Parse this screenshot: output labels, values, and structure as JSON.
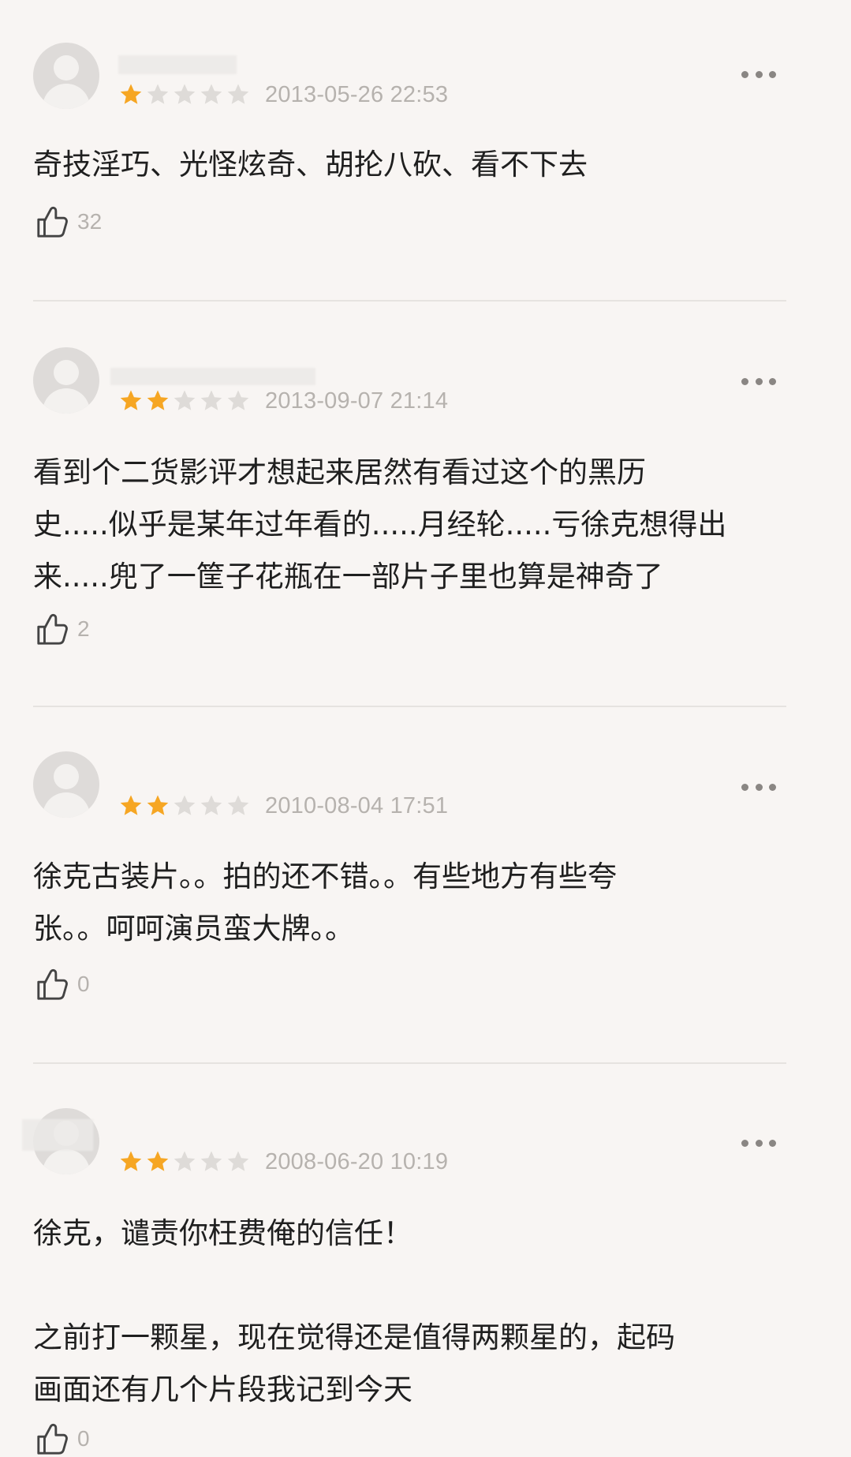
{
  "reviews": [
    {
      "rating": 1,
      "rating_max": 5,
      "date": "2013-05-26 22:53",
      "text": "奇技淫巧、光怪炫奇、胡抡八砍、看不下去",
      "likes": "32"
    },
    {
      "rating": 2,
      "rating_max": 5,
      "date": "2013-09-07 21:14",
      "text": "看到个二货影评才想起来居然有看过这个的黑历\n史.....似乎是某年过年看的.....月经轮.....亏徐克想得出\n来.....兜了一筐子花瓶在一部片子里也算是神奇了",
      "likes": "2"
    },
    {
      "rating": 2,
      "rating_max": 5,
      "date": "2010-08-04 17:51",
      "text": "徐克古装片。。拍的还不错。。有些地方有些夸\n张。。呵呵演员蛮大牌。。",
      "likes": "0"
    },
    {
      "rating": 2,
      "rating_max": 5,
      "date": "2008-06-20 10:19",
      "text": "徐克，谴责你枉费俺的信任！\n\n之前打一颗星，现在觉得还是值得两颗星的，起码\n画面还有几个片段我记到今天",
      "likes": "0"
    }
  ],
  "colors": {
    "star_filled": "#f6a623",
    "star_empty": "#dedbd8",
    "background": "#f8f5f3",
    "meta_text": "#b6b2ae"
  },
  "icons": {
    "like": "thumbs-up-icon",
    "more": "more-dots-icon",
    "star": "star-icon",
    "avatar": "default-avatar-icon"
  }
}
